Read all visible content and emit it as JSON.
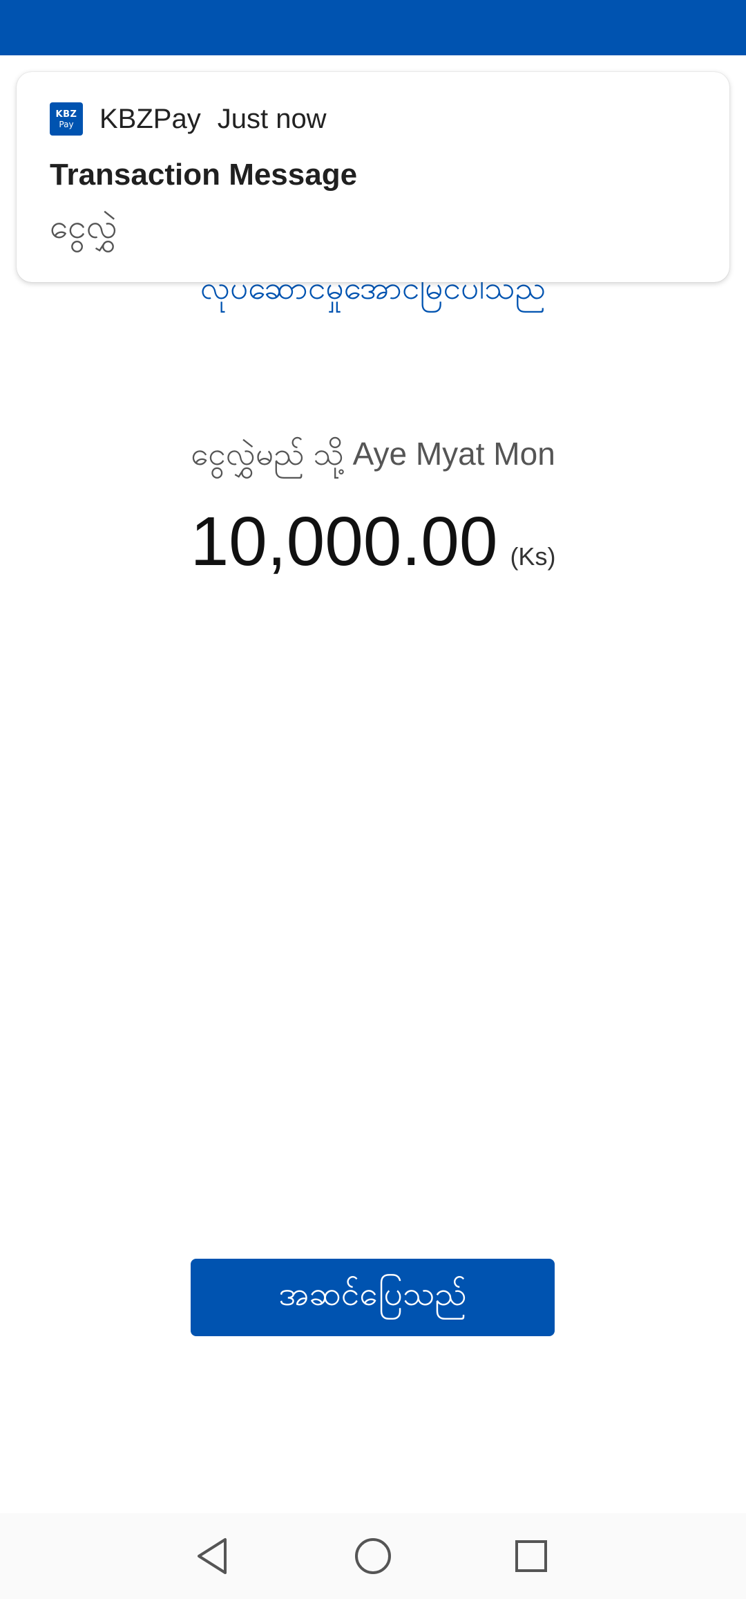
{
  "notification": {
    "app_icon_text_line1": "KBZ",
    "app_icon_text_line2": "Pay",
    "app_name": "KBZPay",
    "time": "Just now",
    "title": "Transaction Message",
    "body": "ငွေလွှဲ"
  },
  "main": {
    "success_text": "လုပ်ဆောင်မှုအောင်မြင်ပါသည်",
    "transfer_to_text": "ငွေလွှဲမည် သို့ Aye Myat Mon",
    "amount": "10,000.00",
    "currency": "(Ks)",
    "done_button_label": "အဆင်ပြေသည်"
  },
  "nav": {
    "back_icon": "back-triangle-icon",
    "home_icon": "home-circle-icon",
    "recents_icon": "recents-square-icon"
  },
  "colors": {
    "brand_blue": "#0053b0",
    "background": "#ffffff"
  }
}
